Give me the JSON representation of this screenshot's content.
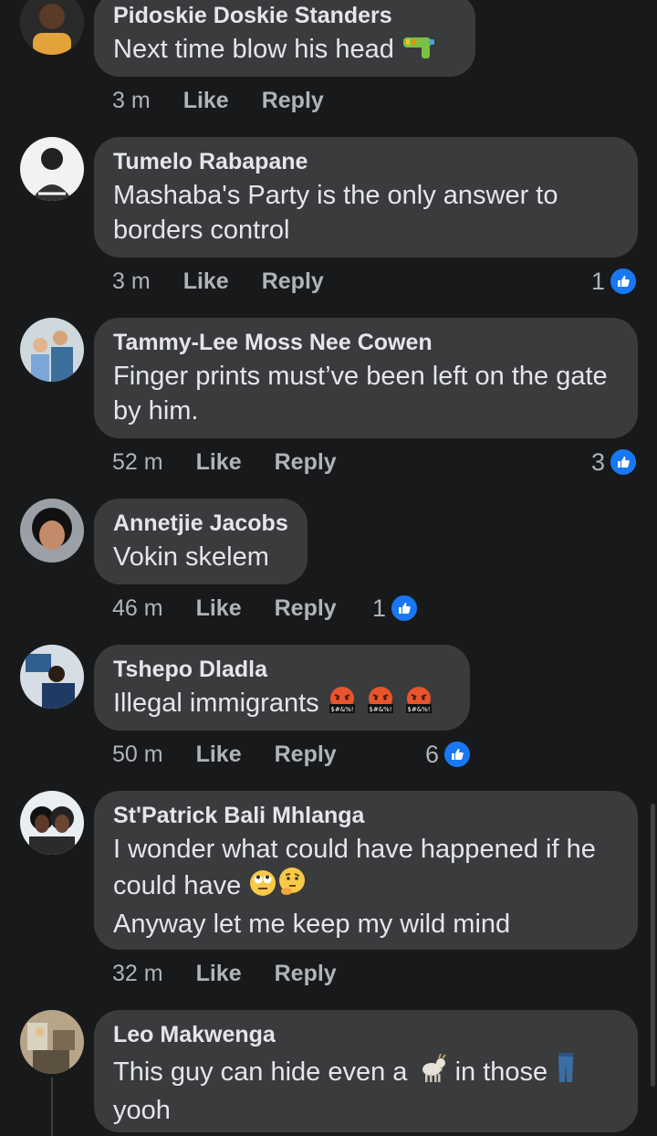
{
  "comments": [
    {
      "author": "Pidoskie Doskie Standers",
      "text": "Next time blow his head",
      "emoji": [
        "water-pistol"
      ],
      "time": "3 m",
      "like": "Like",
      "reply": "Reply",
      "reactions": ""
    },
    {
      "author": "Tumelo Rabapane",
      "text": "Mashaba's Party is the only answer to borders control",
      "time": "3 m",
      "like": "Like",
      "reply": "Reply",
      "reactions": "1"
    },
    {
      "author": "Tammy-Lee Moss Nee Cowen",
      "text": "Finger prints must’ve been left on the gate by him.",
      "time": "52 m",
      "like": "Like",
      "reply": "Reply",
      "reactions": "3"
    },
    {
      "author": "Annetjie Jacobs",
      "text": "Vokin skelem",
      "time": "46 m",
      "like": "Like",
      "reply": "Reply",
      "reactions": "1"
    },
    {
      "author": "Tshepo Dladla",
      "text": "Illegal immigrants",
      "emoji": [
        "cursing-face",
        "cursing-face",
        "cursing-face"
      ],
      "time": "50 m",
      "like": "Like",
      "reply": "Reply",
      "reactions": "6"
    },
    {
      "author": "St'Patrick Bali Mhlanga",
      "text_line1": "I wonder what could have happened if he",
      "text_line2": "could have",
      "text_line3": "Anyway let me keep my wild mind",
      "emoji": [
        "eye-roll-face",
        "thinking-face"
      ],
      "time": "32 m",
      "like": "Like",
      "reply": "Reply",
      "reactions": ""
    },
    {
      "author": "Leo Makwenga",
      "text_a": "This guy can hide even a",
      "text_b": "in those",
      "text_c": "yooh",
      "emoji": [
        "goat",
        "jeans"
      ]
    }
  ],
  "colors": {
    "background": "#18191a",
    "bubble": "#3a3b3c",
    "text": "#e4e6eb",
    "muted": "#b0b3b8",
    "like_blue": "#1877f2"
  }
}
